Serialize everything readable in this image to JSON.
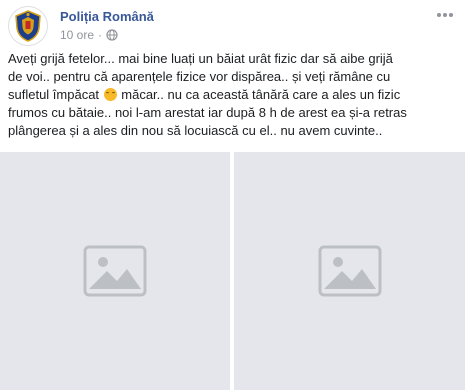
{
  "post": {
    "page_name": "Poliția Română",
    "timestamp": "10 ore",
    "privacy_icon": "globe-icon",
    "more_icon": "ellipsis-icon",
    "text_part1": "Aveți grijă fetelor... mai bine luați un băiat urât fizic dar să aibe grijă\nde voi.. pentru că aparențele fizice vor dispărea.. și veți rămâne cu\nsufletul împăcat ",
    "emoji": "upside-down-face-emoji",
    "text_part2": " măcar.. nu ca această tânără care a ales un fizic\nfrumos cu bătaie.. noi l-am arestat iar după 8 h de arest ea și-a retras\nplângerea și a ales din nou să locuiască cu el.. nu avem cuvinte.."
  },
  "photos": [
    {
      "content": "photo-placeholder"
    },
    {
      "content": "photo-placeholder"
    }
  ],
  "colors": {
    "page_name": "#385898",
    "meta": "#90949c",
    "text": "#1c1e21",
    "crest_blue": "#1d3e8a",
    "crest_gold": "#d4a017",
    "crest_red": "#c62828",
    "placeholder": "#e4e6eb"
  }
}
